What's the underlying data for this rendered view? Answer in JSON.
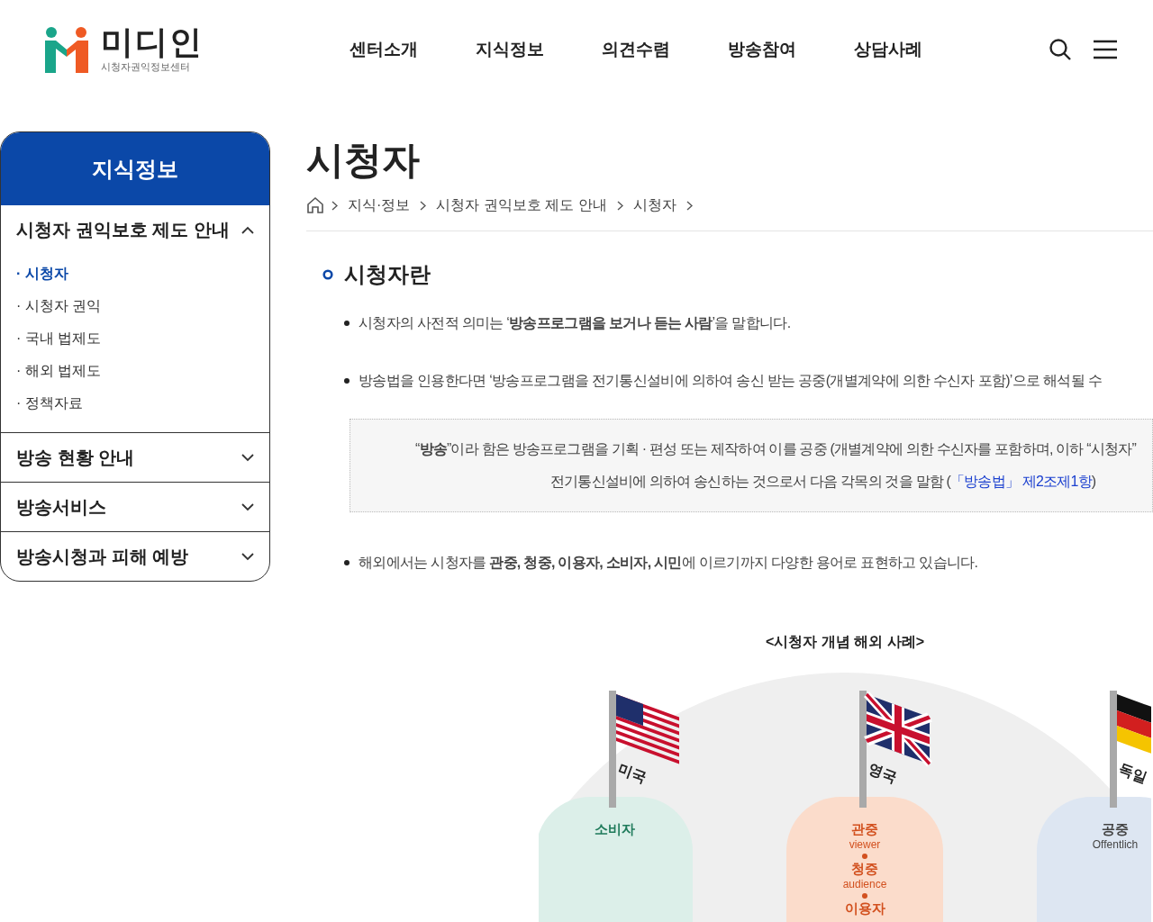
{
  "header": {
    "logo": {
      "title": "미디인",
      "subtitle": "시청자권익정보센터"
    },
    "nav": [
      "센터소개",
      "지식정보",
      "의견수렴",
      "방송참여",
      "상담사례"
    ]
  },
  "sidebar": {
    "title": "지식정보",
    "groups": [
      {
        "label": "시청자 권익보호 제도 안내",
        "expanded": true,
        "items": [
          {
            "label": "· 시청자",
            "selected": true
          },
          {
            "label": "· 시청자 권익",
            "selected": false
          },
          {
            "label": "· 국내 법제도",
            "selected": false
          },
          {
            "label": "· 해외 법제도",
            "selected": false
          },
          {
            "label": "· 정책자료",
            "selected": false
          }
        ]
      },
      {
        "label": "방송 현황 안내",
        "expanded": false
      },
      {
        "label": "방송서비스",
        "expanded": false
      },
      {
        "label": "방송시청과 피해 예방",
        "expanded": false
      }
    ]
  },
  "page": {
    "title": "시청자",
    "breadcrumb": [
      "지식·정보",
      "시청자 권익보호 제도 안내",
      "시청자"
    ]
  },
  "section": {
    "heading": "시청자란",
    "bullets": [
      "시청자의 사전적 의미는 ‘**방송프로그램을 보거나 듣는 사람**’을 말합니다.",
      "방송법을 인용한다면 ‘방송프로그램을 전기통신설비에 의하여 송신 받는 공중(개별계약에 의한 수신자 포함)’으로 해석될 수"
    ],
    "quote": {
      "line1": "“**방송**”이라 함은 방송프로그램을 기획 · 편성 또는 제작하여 이를 공중 (개별계약에 의한 수신자를 포함하며, 이하 “시청자”",
      "line2": "전기통신설비에 의하여 송신하는 것으로서 다음 각목의 것을 말함 (",
      "link": "「방송법」 제2조제1항",
      "close": ")"
    },
    "bullet_after": "해외에서는 시청자를 **관중, 청중, 이용자, 소비자, 시민**에 이르기까지 다양한 용어로 표현하고 있습니다."
  },
  "infographic": {
    "caption": "<시청자 개념 해외 사례>",
    "countries": [
      {
        "name": "미국",
        "kind": "us",
        "color": "#dcefe9",
        "terms": [
          {
            "ko": "소비자"
          }
        ]
      },
      {
        "name": "영국",
        "kind": "uk",
        "color": "#fbdccb",
        "terms": [
          {
            "ko": "관중",
            "en": "viewer"
          },
          {
            "ko": "청중",
            "en": "audience"
          },
          {
            "ko": "이용자"
          }
        ]
      },
      {
        "name": "독일",
        "kind": "de",
        "color": "#dde6f2",
        "terms": [
          {
            "ko": "공중",
            "en": "Offentlich"
          }
        ]
      }
    ]
  }
}
